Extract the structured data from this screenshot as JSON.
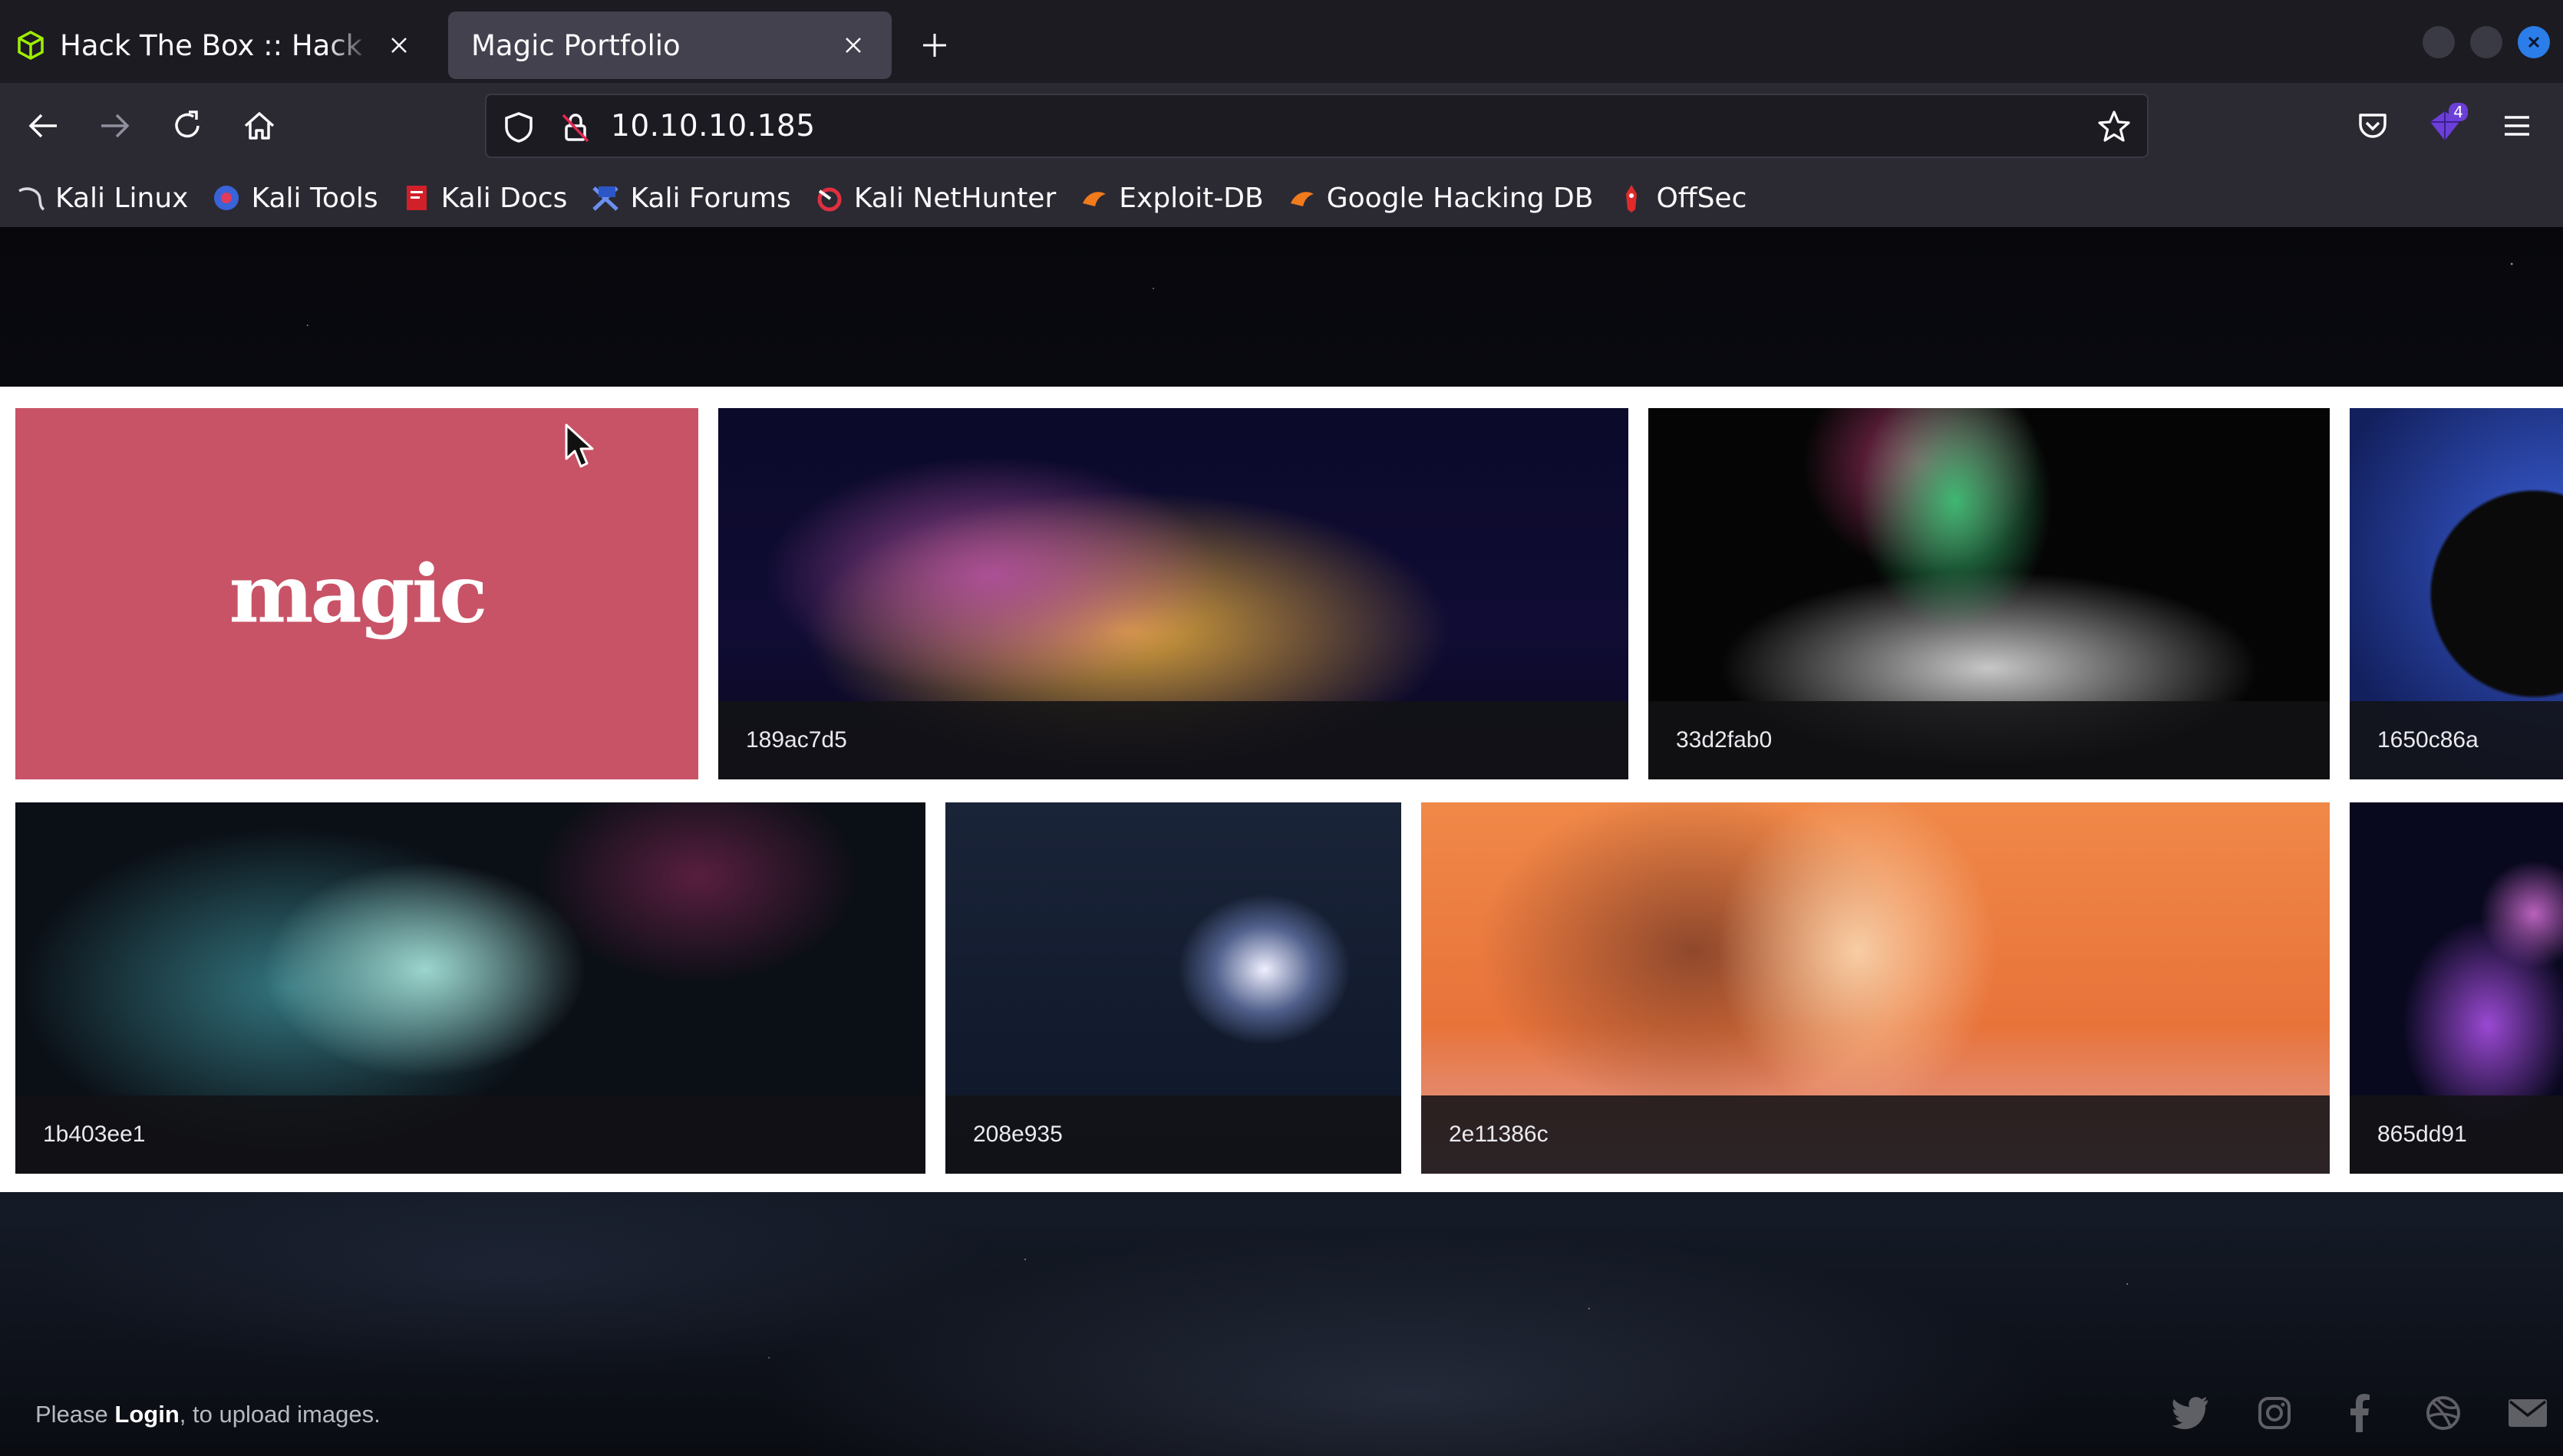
{
  "browser": {
    "tabs": [
      {
        "label": "Hack The Box :: Hack The Box",
        "favicon": "htb-cube-icon",
        "active": false
      },
      {
        "label": "Magic Portfolio",
        "active": true
      }
    ],
    "url": "10.10.10.185",
    "extension_badge": "4",
    "bookmarks": [
      {
        "label": "Kali Linux",
        "icon": "kali-dragon-icon"
      },
      {
        "label": "Kali Tools",
        "icon": "kali-tools-icon"
      },
      {
        "label": "Kali Docs",
        "icon": "kali-docs-icon"
      },
      {
        "label": "Kali Forums",
        "icon": "kali-forums-icon"
      },
      {
        "label": "Kali NetHunter",
        "icon": "kali-nethunter-icon"
      },
      {
        "label": "Exploit-DB",
        "icon": "exploit-db-icon"
      },
      {
        "label": "Google Hacking DB",
        "icon": "ghdb-icon"
      },
      {
        "label": "OffSec",
        "icon": "offsec-icon"
      }
    ],
    "colors": {
      "tabbar": "#1c1b22",
      "toolbar": "#2b2a33",
      "accent": "#2b7de9"
    }
  },
  "page": {
    "logo_text": "magic",
    "gallery": [
      {
        "caption": "189ac7d5"
      },
      {
        "caption": "33d2fab0"
      },
      {
        "caption": "1650c86a"
      },
      {
        "caption": "1b403ee1"
      },
      {
        "caption": "208e935"
      },
      {
        "caption": "2e11386c"
      },
      {
        "caption": "865dd91"
      }
    ],
    "footer": {
      "prefix": "Please ",
      "login_link": "Login",
      "suffix": ", to upload images."
    },
    "social": [
      "twitter-icon",
      "instagram-icon",
      "facebook-icon",
      "dribbble-icon",
      "mail-icon"
    ],
    "colors": {
      "logo_card": "#c85366",
      "band": "#ffffff"
    }
  }
}
